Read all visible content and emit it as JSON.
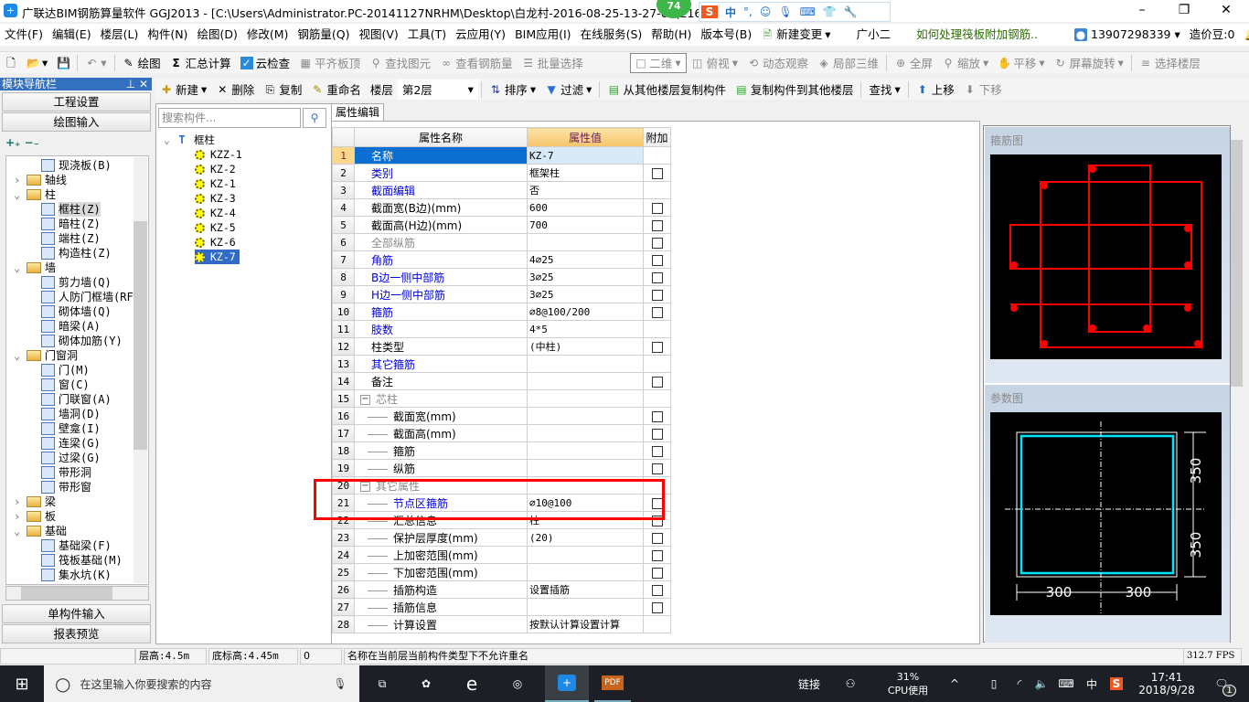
{
  "window": {
    "title": "广联达BIM钢筋算量软件 GGJ2013 - [C:\\Users\\Administrator.PC-20141127NRHM\\Desktop\\白龙村-2016-08-25-13-27-07(216",
    "badge": "74",
    "ime": {
      "lang": "中",
      "punct": "°,"
    }
  },
  "menu": [
    "文件(F)",
    "编辑(E)",
    "楼层(L)",
    "构件(N)",
    "绘图(D)",
    "修改(M)",
    "钢筋量(Q)",
    "视图(V)",
    "工具(T)",
    "云应用(Y)",
    "BIM应用(I)",
    "在线服务(S)",
    "帮助(H)",
    "版本号(B)"
  ],
  "menu_extra": {
    "new_change": "新建变更",
    "assistant": "广小二",
    "tip": "如何处理筏板附加钢筋..",
    "phone": "13907298339",
    "beans": "造价豆:0"
  },
  "toolbar1": {
    "draw": "绘图",
    "sum": "汇总计算",
    "cloud_check": "云检查",
    "align_top": "平齐板顶",
    "find": "查找图元",
    "view_rebar": "查看钢筋量",
    "batch": "批量选择",
    "view_mode": "二维",
    "top_view": "俯视",
    "dynamic": "动态观察",
    "local3d": "局部三维",
    "fullscreen": "全屏",
    "zoom": "缩放",
    "pan": "平移",
    "rotate": "屏幕旋转",
    "select_floor": "选择楼层"
  },
  "toolbar2": {
    "new": "新建",
    "delete": "删除",
    "copy": "复制",
    "rename": "重命名",
    "floor_label": "楼层",
    "floor": "第2层",
    "sort": "排序",
    "filter": "过滤",
    "copy_from": "从其他楼层复制构件",
    "copy_to": "复制构件到其他楼层",
    "find": "查找",
    "up": "上移",
    "down": "下移"
  },
  "nav": {
    "title": "模块导航栏",
    "project": "工程设置",
    "draw_input": "绘图输入",
    "single": "单构件输入",
    "report": "报表预览",
    "tree": [
      {
        "l": "现浇板(B)",
        "lvl": 2
      },
      {
        "l": "轴线",
        "lvl": 1,
        "folder": true,
        "open": false
      },
      {
        "l": "柱",
        "lvl": 1,
        "folder": true,
        "open": true
      },
      {
        "l": "框柱(Z)",
        "lvl": 2,
        "sel": true
      },
      {
        "l": "暗柱(Z)",
        "lvl": 2
      },
      {
        "l": "端柱(Z)",
        "lvl": 2
      },
      {
        "l": "构造柱(Z)",
        "lvl": 2
      },
      {
        "l": "墙",
        "lvl": 1,
        "folder": true,
        "open": true
      },
      {
        "l": "剪力墙(Q)",
        "lvl": 2
      },
      {
        "l": "人防门框墙(RF",
        "lvl": 2
      },
      {
        "l": "砌体墙(Q)",
        "lvl": 2
      },
      {
        "l": "暗梁(A)",
        "lvl": 2
      },
      {
        "l": "砌体加筋(Y)",
        "lvl": 2
      },
      {
        "l": "门窗洞",
        "lvl": 1,
        "folder": true,
        "open": true
      },
      {
        "l": "门(M)",
        "lvl": 2
      },
      {
        "l": "窗(C)",
        "lvl": 2
      },
      {
        "l": "门联窗(A)",
        "lvl": 2
      },
      {
        "l": "墙洞(D)",
        "lvl": 2
      },
      {
        "l": "壁龛(I)",
        "lvl": 2
      },
      {
        "l": "连梁(G)",
        "lvl": 2
      },
      {
        "l": "过梁(G)",
        "lvl": 2
      },
      {
        "l": "带形洞",
        "lvl": 2
      },
      {
        "l": "带形窗",
        "lvl": 2
      },
      {
        "l": "梁",
        "lvl": 1,
        "folder": true,
        "open": false
      },
      {
        "l": "板",
        "lvl": 1,
        "folder": true,
        "open": false
      },
      {
        "l": "基础",
        "lvl": 1,
        "folder": true,
        "open": true
      },
      {
        "l": "基础梁(F)",
        "lvl": 2
      },
      {
        "l": "筏板基础(M)",
        "lvl": 2
      },
      {
        "l": "集水坑(K)",
        "lvl": 2
      }
    ]
  },
  "components": {
    "search_placeholder": "搜索构件...",
    "root": "框柱",
    "items": [
      "KZZ-1",
      "KZ-2",
      "KZ-1",
      "KZ-3",
      "KZ-4",
      "KZ-5",
      "KZ-6",
      "KZ-7"
    ],
    "selected": "KZ-7"
  },
  "props": {
    "tab": "属性编辑",
    "headers": [
      "属性名称",
      "属性值",
      "附加"
    ],
    "rows": [
      {
        "n": "1",
        "name": "名称",
        "val": "KZ-7",
        "cb": false,
        "style": "sel"
      },
      {
        "n": "2",
        "name": "类别",
        "val": "框架柱",
        "cb": true,
        "style": "blue"
      },
      {
        "n": "3",
        "name": "截面编辑",
        "val": "否",
        "cb": false,
        "style": "blue"
      },
      {
        "n": "4",
        "name": "截面宽(B边)(mm)",
        "val": "600",
        "cb": true,
        "style": ""
      },
      {
        "n": "5",
        "name": "截面高(H边)(mm)",
        "val": "700",
        "cb": true,
        "style": ""
      },
      {
        "n": "6",
        "name": "全部纵筋",
        "val": "",
        "cb": true,
        "style": "gray"
      },
      {
        "n": "7",
        "name": "角筋",
        "val": "4⌀25",
        "cb": true,
        "style": "blue"
      },
      {
        "n": "8",
        "name": "B边一侧中部筋",
        "val": "3⌀25",
        "cb": true,
        "style": "blue"
      },
      {
        "n": "9",
        "name": "H边一侧中部筋",
        "val": "3⌀25",
        "cb": true,
        "style": "blue"
      },
      {
        "n": "10",
        "name": "箍筋",
        "val": "⌀8@100/200",
        "cb": true,
        "style": "blue"
      },
      {
        "n": "11",
        "name": "肢数",
        "val": "4*5",
        "cb": false,
        "style": "blue"
      },
      {
        "n": "12",
        "name": "柱类型",
        "val": "(中柱)",
        "cb": true,
        "style": ""
      },
      {
        "n": "13",
        "name": "其它箍筋",
        "val": "",
        "cb": false,
        "style": "blue"
      },
      {
        "n": "14",
        "name": "备注",
        "val": "",
        "cb": true,
        "style": ""
      },
      {
        "n": "15",
        "name": "芯柱",
        "val": "",
        "cb": false,
        "style": "grp"
      },
      {
        "n": "16",
        "name": "截面宽(mm)",
        "val": "",
        "cb": true,
        "style": "child"
      },
      {
        "n": "17",
        "name": "截面高(mm)",
        "val": "",
        "cb": true,
        "style": "child"
      },
      {
        "n": "18",
        "name": "箍筋",
        "val": "",
        "cb": true,
        "style": "child"
      },
      {
        "n": "19",
        "name": "纵筋",
        "val": "",
        "cb": true,
        "style": "child"
      },
      {
        "n": "20",
        "name": "其它属性",
        "val": "",
        "cb": false,
        "style": "grp"
      },
      {
        "n": "21",
        "name": "节点区箍筋",
        "val": "⌀10@100",
        "cb": true,
        "style": "child blue"
      },
      {
        "n": "22",
        "name": "汇总信息",
        "val": "柱",
        "cb": true,
        "style": "child"
      },
      {
        "n": "23",
        "name": "保护层厚度(mm)",
        "val": "(20)",
        "cb": true,
        "style": "child"
      },
      {
        "n": "24",
        "name": "上加密范围(mm)",
        "val": "",
        "cb": true,
        "style": "child"
      },
      {
        "n": "25",
        "name": "下加密范围(mm)",
        "val": "",
        "cb": true,
        "style": "child"
      },
      {
        "n": "26",
        "name": "插筋构造",
        "val": "设置插筋",
        "cb": true,
        "style": "child"
      },
      {
        "n": "27",
        "name": "插筋信息",
        "val": "",
        "cb": true,
        "style": "child"
      },
      {
        "n": "28",
        "name": "计算设置",
        "val": "按默认计算设置计算",
        "cb": false,
        "style": "child"
      }
    ]
  },
  "preview": {
    "stirrup_title": "箍筋图",
    "param_title": "参数图",
    "dim_h": "350",
    "dim_h2": "350",
    "dim_w": "300",
    "dim_w2": "300"
  },
  "status": {
    "floor_h": "层高:4.5m",
    "base_h": "底标高:4.45m",
    "zero": "0",
    "msg": "名称在当前层当前构件类型下不允许重名",
    "fps": "312.7 FPS"
  },
  "taskbar": {
    "search": "在这里输入你要搜索的内容",
    "link": "链接",
    "cpu": "31%",
    "cpu_label": "CPU使用",
    "ime": "中",
    "time": "17:41",
    "date": "2018/9/28",
    "notif": "1"
  },
  "colors": {
    "accent": "#0b6fd1",
    "nav_header": "#3470c0",
    "highlight": "#ff0000",
    "stirrup": "#ff0000",
    "param": "#00e5ff"
  }
}
